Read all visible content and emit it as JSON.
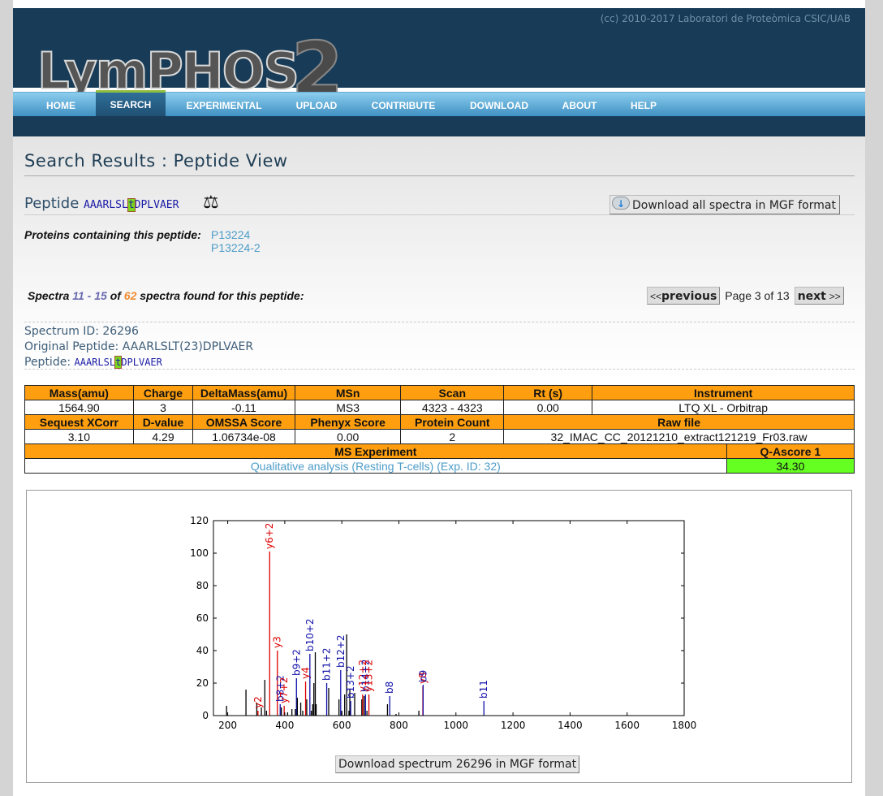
{
  "header": {
    "logo_text": "LymPHOS",
    "logo_suffix": "2",
    "copyright": "(cc) 2010-2017 Laboratori de Proteòmica CSIC/UAB"
  },
  "nav": {
    "items": [
      {
        "label": "HOME",
        "active": false
      },
      {
        "label": "SEARCH",
        "active": true
      },
      {
        "label": "EXPERIMENTAL",
        "active": false
      },
      {
        "label": "UPLOAD",
        "active": false
      },
      {
        "label": "CONTRIBUTE",
        "active": false
      },
      {
        "label": "DOWNLOAD",
        "active": false
      },
      {
        "label": "ABOUT",
        "active": false
      },
      {
        "label": "HELP",
        "active": false
      }
    ]
  },
  "page": {
    "title": "Search Results : Peptide View",
    "peptide_label": "Peptide",
    "peptide_seq_before": "AAARLSL",
    "peptide_mod_residue": "t",
    "peptide_seq_after": "DPLVAER",
    "download_all_label": "Download all spectra in MGF format",
    "proteins_label": "Proteins containing this peptide:",
    "proteins": [
      "P13224",
      "P13224-2"
    ]
  },
  "pagination": {
    "spectra_prefix": "Spectra",
    "range": "11 - 15",
    "of_label": "of",
    "total": "62",
    "suffix": "spectra found for this peptide:",
    "previous_arrows": "<<",
    "previous_label": "previous",
    "page_info": "Page 3 of 13",
    "next_label": "next",
    "next_arrows": ">>"
  },
  "spectrum": {
    "id_line": "Spectrum ID: 26296",
    "original_peptide_line": "Original Peptide: AAARLSLT(23)DPLVAER",
    "peptide_label": "Peptide:",
    "seq_before": "AAARLSL",
    "mod_residue": "t",
    "seq_after": "DPLVAER",
    "download_label": "Download spectrum 26296 in MGF format"
  },
  "meta_table": {
    "row1_headers": [
      "Mass(amu)",
      "Charge",
      "DeltaMass(amu)",
      "MSn",
      "Scan",
      "Rt (s)",
      "Instrument"
    ],
    "row1_values": [
      "1564.90",
      "3",
      "-0.11",
      "MS3",
      "4323 - 4323",
      "0.00",
      "LTQ XL - Orbitrap"
    ],
    "row2_headers": [
      "Sequest XCorr",
      "D-value",
      "OMSSA Score",
      "Phenyx Score",
      "Protein Count",
      "Raw file"
    ],
    "row2_values": [
      "3.10",
      "4.29",
      "1.06734e-08",
      "0.00",
      "2",
      "32_IMAC_CC_20121210_extract121219_Fr03.raw"
    ],
    "row3_headers": [
      "MS Experiment",
      "Q-Ascore 1"
    ],
    "row3_values": [
      "Qualitative analysis (Resting T-cells) (Exp. ID: 32)",
      "34.30"
    ],
    "score_color": "#66ff22",
    "header_color": "#ff9f0f"
  },
  "chart_data": {
    "type": "bar",
    "title": "",
    "xlabel": "",
    "ylabel": "",
    "xlim": [
      150,
      1800
    ],
    "ylim": [
      0,
      120
    ],
    "xticks": [
      200,
      400,
      600,
      800,
      1000,
      1200,
      1400,
      1600,
      1800
    ],
    "yticks": [
      0,
      20,
      40,
      60,
      80,
      100,
      120
    ],
    "grid": false,
    "colors": {
      "unassigned": "#000000",
      "y_ion": "#dd0000",
      "b_ion": "#1010aa"
    },
    "peaks": [
      {
        "mz": 196,
        "intensity": 6,
        "type": "unassigned",
        "label": ""
      },
      {
        "mz": 264,
        "intensity": 16,
        "type": "unassigned",
        "label": ""
      },
      {
        "mz": 302,
        "intensity": 8,
        "type": "unassigned",
        "label": ""
      },
      {
        "mz": 306,
        "intensity": 3,
        "type": "y_ion",
        "label": "y2"
      },
      {
        "mz": 318,
        "intensity": 5,
        "type": "unassigned",
        "label": ""
      },
      {
        "mz": 330,
        "intensity": 22,
        "type": "unassigned",
        "label": ""
      },
      {
        "mz": 336,
        "intensity": 3,
        "type": "unassigned",
        "label": ""
      },
      {
        "mz": 347,
        "intensity": 101,
        "type": "y_ion",
        "label": "y6+2"
      },
      {
        "mz": 374,
        "intensity": 40,
        "type": "y_ion",
        "label": "y3"
      },
      {
        "mz": 384,
        "intensity": 7,
        "type": "b_ion",
        "label": "b8+2"
      },
      {
        "mz": 388,
        "intensity": 5,
        "type": "unassigned",
        "label": ""
      },
      {
        "mz": 398,
        "intensity": 6,
        "type": "y_ion",
        "label": "y7+2"
      },
      {
        "mz": 410,
        "intensity": 2,
        "type": "unassigned",
        "label": ""
      },
      {
        "mz": 425,
        "intensity": 4,
        "type": "unassigned",
        "label": ""
      },
      {
        "mz": 437,
        "intensity": 4,
        "type": "unassigned",
        "label": ""
      },
      {
        "mz": 441,
        "intensity": 23,
        "type": "b_ion",
        "label": "b9+2"
      },
      {
        "mz": 444,
        "intensity": 11,
        "type": "unassigned",
        "label": ""
      },
      {
        "mz": 456,
        "intensity": 8,
        "type": "unassigned",
        "label": ""
      },
      {
        "mz": 463,
        "intensity": 3,
        "type": "unassigned",
        "label": ""
      },
      {
        "mz": 473,
        "intensity": 21,
        "type": "y_ion",
        "label": "y4"
      },
      {
        "mz": 477,
        "intensity": 10,
        "type": "unassigned",
        "label": ""
      },
      {
        "mz": 488,
        "intensity": 38,
        "type": "b_ion",
        "label": "b10+2"
      },
      {
        "mz": 493,
        "intensity": 3,
        "type": "unassigned",
        "label": ""
      },
      {
        "mz": 498,
        "intensity": 7,
        "type": "unassigned",
        "label": ""
      },
      {
        "mz": 502,
        "intensity": 20,
        "type": "unassigned",
        "label": ""
      },
      {
        "mz": 507,
        "intensity": 39,
        "type": "unassigned",
        "label": ""
      },
      {
        "mz": 510,
        "intensity": 7,
        "type": "unassigned",
        "label": ""
      },
      {
        "mz": 547,
        "intensity": 20,
        "type": "b_ion",
        "label": "b11+2"
      },
      {
        "mz": 554,
        "intensity": 17,
        "type": "unassigned",
        "label": ""
      },
      {
        "mz": 590,
        "intensity": 10,
        "type": "unassigned",
        "label": ""
      },
      {
        "mz": 596,
        "intensity": 28,
        "type": "b_ion",
        "label": "b12+2"
      },
      {
        "mz": 600,
        "intensity": 3,
        "type": "unassigned",
        "label": ""
      },
      {
        "mz": 610,
        "intensity": 13,
        "type": "unassigned",
        "label": ""
      },
      {
        "mz": 617,
        "intensity": 50,
        "type": "unassigned",
        "label": ""
      },
      {
        "mz": 625,
        "intensity": 3,
        "type": "unassigned",
        "label": ""
      },
      {
        "mz": 628,
        "intensity": 16,
        "type": "unassigned",
        "label": ""
      },
      {
        "mz": 631,
        "intensity": 9,
        "type": "b_ion",
        "label": "b13+2"
      },
      {
        "mz": 645,
        "intensity": 14,
        "type": "unassigned",
        "label": ""
      },
      {
        "mz": 670,
        "intensity": 10,
        "type": "unassigned",
        "label": ""
      },
      {
        "mz": 673,
        "intensity": 13,
        "type": "y_ion",
        "label": "y12+2"
      },
      {
        "mz": 678,
        "intensity": 12,
        "type": "unassigned",
        "label": ""
      },
      {
        "mz": 683,
        "intensity": 13,
        "type": "b_ion",
        "label": "b14+2"
      },
      {
        "mz": 688,
        "intensity": 3,
        "type": "unassigned",
        "label": ""
      },
      {
        "mz": 695,
        "intensity": 13,
        "type": "y_ion",
        "label": "y13+2"
      },
      {
        "mz": 760,
        "intensity": 7,
        "type": "unassigned",
        "label": ""
      },
      {
        "mz": 768,
        "intensity": 12,
        "type": "b_ion",
        "label": "b8"
      },
      {
        "mz": 790,
        "intensity": 1,
        "type": "unassigned",
        "label": ""
      },
      {
        "mz": 870,
        "intensity": 3,
        "type": "unassigned",
        "label": ""
      },
      {
        "mz": 884,
        "intensity": 18,
        "type": "y_ion",
        "label": "y8"
      },
      {
        "mz": 885,
        "intensity": 19,
        "type": "b_ion",
        "label": "b9"
      },
      {
        "mz": 1098,
        "intensity": 9,
        "type": "b_ion",
        "label": "b11"
      }
    ]
  }
}
